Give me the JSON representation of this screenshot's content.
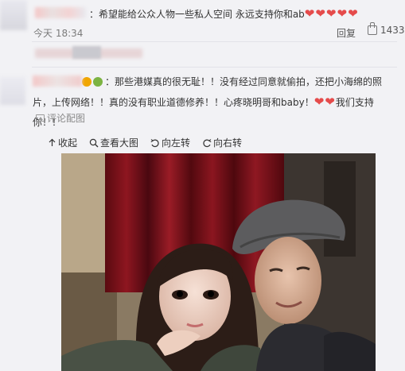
{
  "top_comment": {
    "text": "：希望能给公众人物一些私人空间 永远支持你和ab",
    "hearts": "❤❤❤❤❤",
    "time": "今天 18:34",
    "reply_label": "回复",
    "like_count": "1433"
  },
  "comment2": {
    "text_part1": "：那些港媒真的很无耻！！没有经过同意就偷拍，还把小海绵的照片，上传网络！！真的没有职业道德修养！！心疼晓明哥和baby！",
    "hearts": "❤❤",
    "text_part2": "我们支持你！！",
    "view_image_label": "评论配图"
  },
  "image_toolbar": {
    "collapse": "收起",
    "view_large": "查看大图",
    "rotate_left": "向左转",
    "rotate_right": "向右转"
  },
  "colors": {
    "heart": "#e54b4b",
    "background": "#f2f2f5"
  }
}
